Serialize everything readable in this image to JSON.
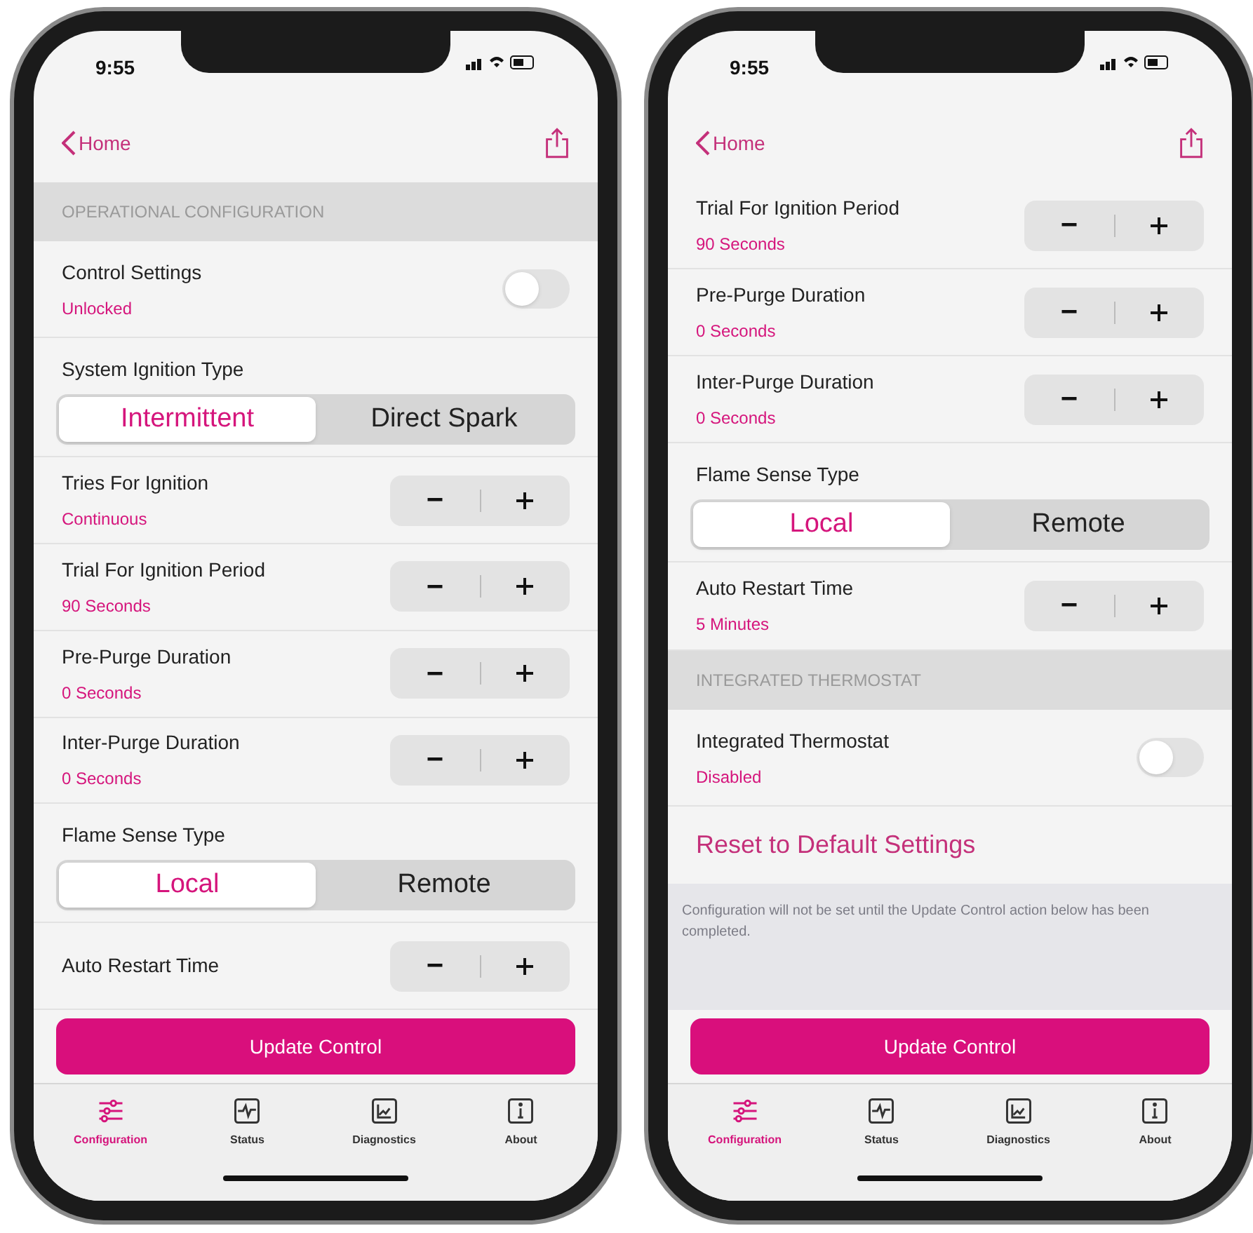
{
  "phones": [
    {
      "time": "9:55",
      "back": "Home",
      "rows": [
        {
          "kind": "section",
          "title": "OPERATIONAL CONFIGURATION"
        },
        {
          "kind": "toggle",
          "title": "Control Settings",
          "value": "Unlocked",
          "on": false
        },
        {
          "kind": "segmented",
          "title": "System Ignition Type",
          "options": [
            {
              "label": "Intermittent",
              "selected": true
            },
            {
              "label": "Direct Spark",
              "selected": false
            }
          ]
        },
        {
          "kind": "stepper",
          "title": "Tries For Ignition",
          "value": "Continuous"
        },
        {
          "kind": "stepper",
          "title": "Trial For Ignition Period",
          "value": "90 Seconds"
        },
        {
          "kind": "stepper",
          "title": "Pre-Purge Duration",
          "value": "0 Seconds"
        },
        {
          "kind": "stepper",
          "title": "Inter-Purge Duration",
          "value": "0 Seconds"
        },
        {
          "kind": "segmented",
          "title": "Flame Sense Type",
          "options": [
            {
              "label": "Local",
              "selected": true
            },
            {
              "label": "Remote",
              "selected": false
            }
          ]
        },
        {
          "kind": "stepper",
          "title": "Auto Restart Time"
        }
      ],
      "update_button": "Update Control",
      "tabs": [
        {
          "label": "Configuration",
          "selected": true
        },
        {
          "label": "Status",
          "selected": false
        },
        {
          "label": "Diagnostics",
          "selected": false
        },
        {
          "label": "About",
          "selected": false
        }
      ]
    },
    {
      "time": "9:55",
      "back": "Home",
      "rows": [
        {
          "kind": "stepper",
          "title": "Trial For Ignition Period",
          "value": "90 Seconds"
        },
        {
          "kind": "stepper",
          "title": "Pre-Purge Duration",
          "value": "0 Seconds"
        },
        {
          "kind": "stepper",
          "title": "Inter-Purge Duration",
          "value": "0 Seconds"
        },
        {
          "kind": "segmented",
          "title": "Flame Sense Type",
          "options": [
            {
              "label": "Local",
              "selected": true
            },
            {
              "label": "Remote",
              "selected": false
            }
          ]
        },
        {
          "kind": "stepper",
          "title": "Auto Restart Time",
          "value": "5 Minutes"
        },
        {
          "kind": "section",
          "title": "INTEGRATED THERMOSTAT"
        },
        {
          "kind": "toggle",
          "title": "Integrated Thermostat",
          "value": "Disabled",
          "on": false
        },
        {
          "kind": "link",
          "title": "Reset to Default Settings"
        },
        {
          "kind": "note",
          "title": "Configuration will not be set until the Update Control action below has been completed."
        }
      ],
      "update_button": "Update Control",
      "tabs": [
        {
          "label": "Configuration",
          "selected": true
        },
        {
          "label": "Status",
          "selected": false
        },
        {
          "label": "Diagnostics",
          "selected": false
        },
        {
          "label": "About",
          "selected": false
        }
      ]
    }
  ]
}
